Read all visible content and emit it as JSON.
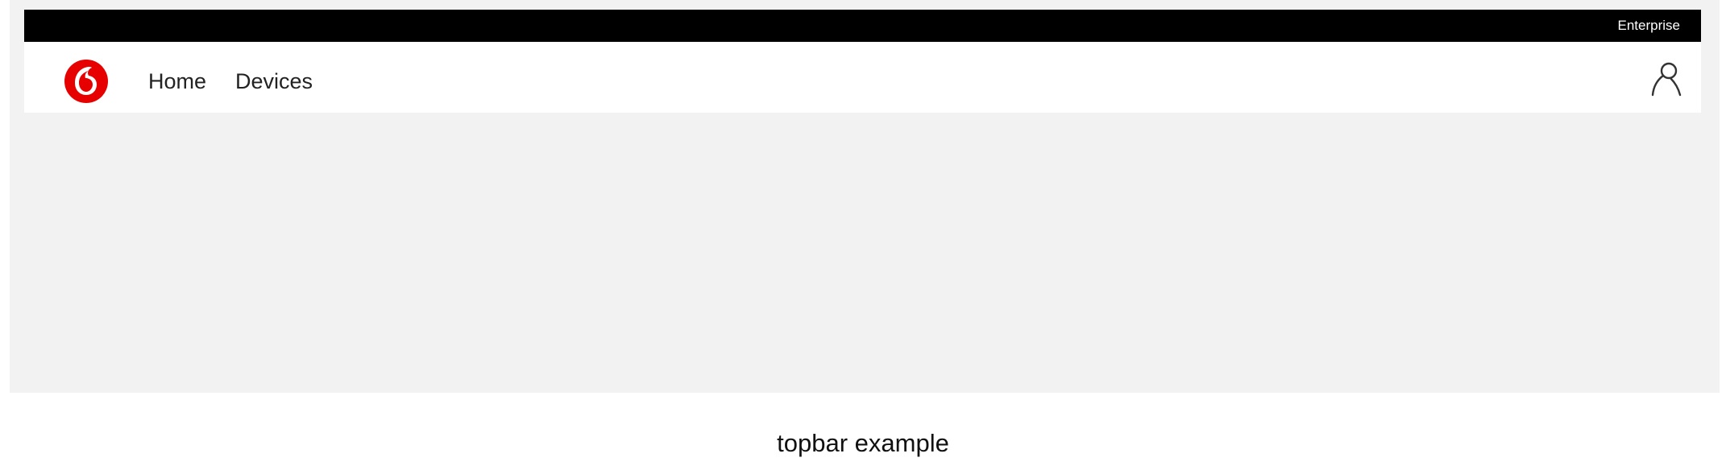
{
  "topstrip": {
    "label": "Enterprise"
  },
  "navbar": {
    "logo": {
      "icon": "vodafone-logo-icon",
      "color": "#e60000"
    },
    "links": [
      {
        "label": "Home"
      },
      {
        "label": "Devices"
      }
    ],
    "account": {
      "icon": "user-icon"
    }
  },
  "caption": "topbar example",
  "colors": {
    "topstrip_bg": "#000000",
    "navbar_bg": "#ffffff",
    "page_bg": "#f2f2f2",
    "brand": "#e60000"
  }
}
